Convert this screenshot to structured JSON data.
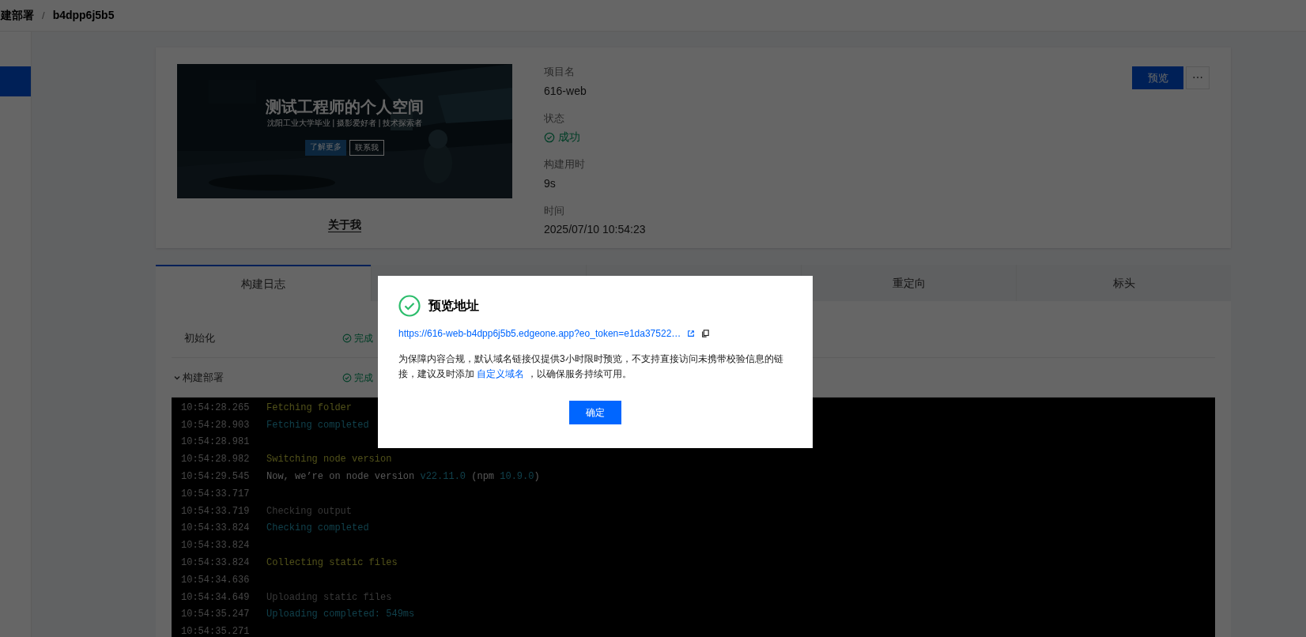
{
  "breadcrumb": {
    "parent": "建部署",
    "separator": "/",
    "current": "b4dpp6j5b5"
  },
  "project": {
    "preview_image": {
      "kind": "picture",
      "title": "测试工程师的个人空间",
      "subtitle": "沈阳工业大学毕业 | 摄影爱好者 | 技术探索者",
      "buttons": [
        "了解更多",
        "联系我"
      ]
    },
    "caption": "关于我",
    "fields": [
      {
        "label": "项目名",
        "value": "616-web",
        "kind": "text"
      },
      {
        "label": "状态",
        "value": "成功",
        "kind": "status"
      },
      {
        "label": "构建用时",
        "value": "9s",
        "kind": "text"
      },
      {
        "label": "时间",
        "value": "2025/07/10 10:54:23",
        "kind": "text"
      }
    ],
    "preview_button": "预览",
    "more_button": "⋯"
  },
  "tabs": [
    {
      "label": "构建日志",
      "selected": true
    },
    {
      "label": "重定向",
      "selected": false
    },
    {
      "label": "标头",
      "selected": false
    }
  ],
  "steps": [
    {
      "name": "初始化",
      "status": "完成",
      "kind": "plain"
    },
    {
      "name": "构建部署",
      "status": "完成",
      "expanded": true,
      "kind": "toggle"
    }
  ],
  "log": [
    {
      "time": "10:54:28.265",
      "segments": [
        {
          "text": "Fetching folder",
          "kind": "step"
        }
      ]
    },
    {
      "time": "10:54:28.903",
      "segments": [
        {
          "text": "Fetching completed",
          "kind": "done"
        }
      ]
    },
    {
      "time": "10:54:28.981"
    },
    {
      "time": "10:54:28.982",
      "segments": [
        {
          "text": "Switching node version",
          "kind": "step"
        }
      ]
    },
    {
      "time": "10:54:29.545",
      "segments": [
        {
          "text": "Now, we’re on node version ",
          "kind": "info"
        },
        {
          "text": "v22.11.0",
          "kind": "done"
        },
        {
          "text": " (npm ",
          "kind": "info"
        },
        {
          "text": "10.9.0",
          "kind": "done"
        },
        {
          "text": ")",
          "kind": "info"
        }
      ]
    },
    {
      "time": "10:54:33.717"
    },
    {
      "time": "10:54:33.719",
      "segments": [
        {
          "text": "Checking output",
          "kind": "muted"
        }
      ]
    },
    {
      "time": "10:54:33.824",
      "segments": [
        {
          "text": "Checking completed",
          "kind": "done"
        }
      ]
    },
    {
      "time": "10:54:33.824"
    },
    {
      "time": "10:54:33.824",
      "segments": [
        {
          "text": "Collecting static files",
          "kind": "step"
        }
      ]
    },
    {
      "time": "10:54:34.636"
    },
    {
      "time": "10:54:34.649",
      "segments": [
        {
          "text": "Uploading static files",
          "kind": "muted"
        }
      ]
    },
    {
      "time": "10:54:35.247",
      "segments": [
        {
          "text": "Uploading completed: 549ms",
          "kind": "done"
        }
      ]
    },
    {
      "time": "10:54:35.271"
    }
  ],
  "dialog": {
    "title": "预览地址",
    "url": "https://616-web-b4dpp6j5b5.edgeone.app?eo_token=e1da37522…",
    "message": "为保障内容合规，默认域名链接仅提供3小时限时预览，不支持直接访问未携带校验信息的链接，建议及时添加 ",
    "message_link": "自定义域名",
    "message_end": " ，以确保服务持续可用。",
    "confirm": "确定"
  }
}
